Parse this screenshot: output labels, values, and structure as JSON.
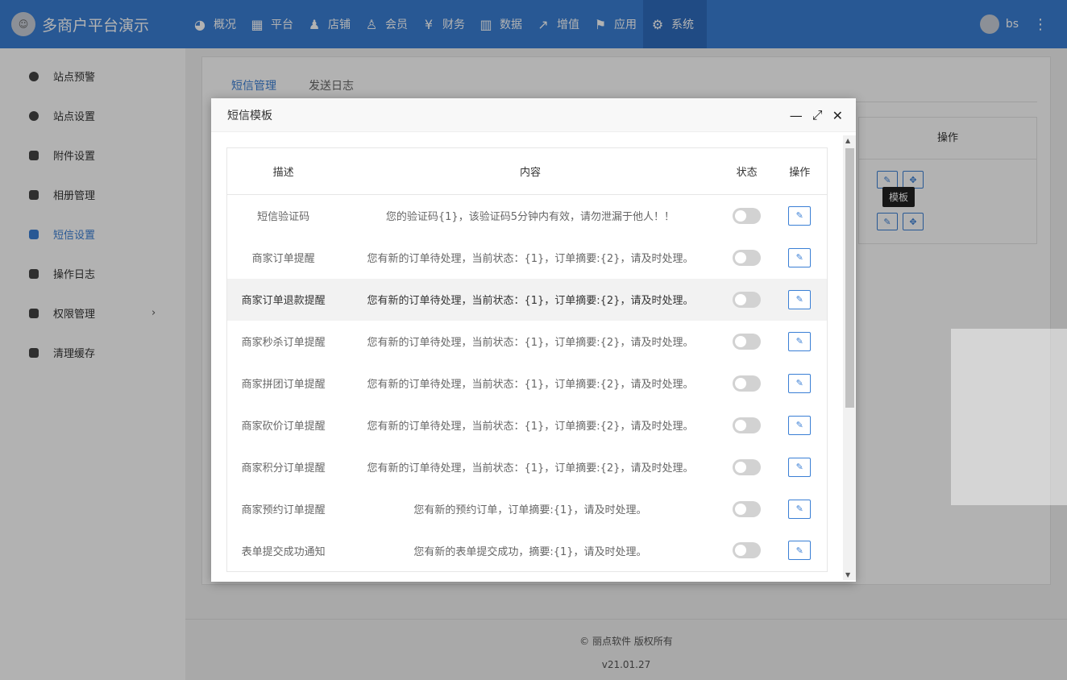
{
  "header": {
    "brand_title": "多商户平台演示",
    "nav": [
      {
        "label": "概况",
        "icon": "dashboard-icon",
        "glyph": "◕"
      },
      {
        "label": "平台",
        "icon": "grid-icon",
        "glyph": "▦"
      },
      {
        "label": "店铺",
        "icon": "users-icon",
        "glyph": "♟"
      },
      {
        "label": "会员",
        "icon": "add-user-icon",
        "glyph": "♙"
      },
      {
        "label": "财务",
        "icon": "yen-icon",
        "glyph": "¥"
      },
      {
        "label": "数据",
        "icon": "bar-chart-icon",
        "glyph": "▥"
      },
      {
        "label": "增值",
        "icon": "line-chart-icon",
        "glyph": "↗"
      },
      {
        "label": "应用",
        "icon": "flag-icon",
        "glyph": "⚑"
      },
      {
        "label": "系统",
        "icon": "gear-icon",
        "glyph": "⚙"
      }
    ],
    "user_name": "bs",
    "more_glyph": "⋮"
  },
  "sidebar": {
    "items": [
      {
        "label": "站点预警"
      },
      {
        "label": "站点设置"
      },
      {
        "label": "附件设置"
      },
      {
        "label": "相册管理"
      },
      {
        "label": "短信设置"
      },
      {
        "label": "操作日志"
      },
      {
        "label": "权限管理"
      },
      {
        "label": "清理缓存"
      }
    ],
    "active_index": 4,
    "chevron": "›"
  },
  "main": {
    "tabs": [
      "短信管理",
      "发送日志"
    ],
    "bg_table_header": "操作",
    "tooltip": "模板"
  },
  "modal": {
    "title": "短信模板",
    "columns": {
      "desc": "描述",
      "content": "内容",
      "state": "状态",
      "op": "操作"
    },
    "rows": [
      {
        "desc": "短信验证码",
        "content": "您的验证码{1}，该验证码5分钟内有效，请勿泄漏于他人！！"
      },
      {
        "desc": "商家订单提醒",
        "content": "您有新的订单待处理，当前状态：{1}，订单摘要:{2}，请及时处理。"
      },
      {
        "desc": "商家订单退款提醒",
        "content": "您有新的订单待处理，当前状态：{1}，订单摘要:{2}，请及时处理。"
      },
      {
        "desc": "商家秒杀订单提醒",
        "content": "您有新的订单待处理，当前状态：{1}，订单摘要:{2}，请及时处理。"
      },
      {
        "desc": "商家拼团订单提醒",
        "content": "您有新的订单待处理，当前状态：{1}，订单摘要:{2}，请及时处理。"
      },
      {
        "desc": "商家砍价订单提醒",
        "content": "您有新的订单待处理，当前状态：{1}，订单摘要:{2}，请及时处理。"
      },
      {
        "desc": "商家积分订单提醒",
        "content": "您有新的订单待处理，当前状态：{1}，订单摘要:{2}，请及时处理。"
      },
      {
        "desc": "商家预约订单提醒",
        "content": "您有新的预约订单，订单摘要:{1}，请及时处理。"
      },
      {
        "desc": "表单提交成功通知",
        "content": "您有新的表单提交成功，摘要:{1}，请及时处理。"
      }
    ]
  },
  "footer": {
    "copyright": "© 丽点软件 版权所有",
    "version": "v21.01.27"
  },
  "colors": {
    "accent": "#3a7fd5",
    "active_nav": "#2e6cbd"
  }
}
